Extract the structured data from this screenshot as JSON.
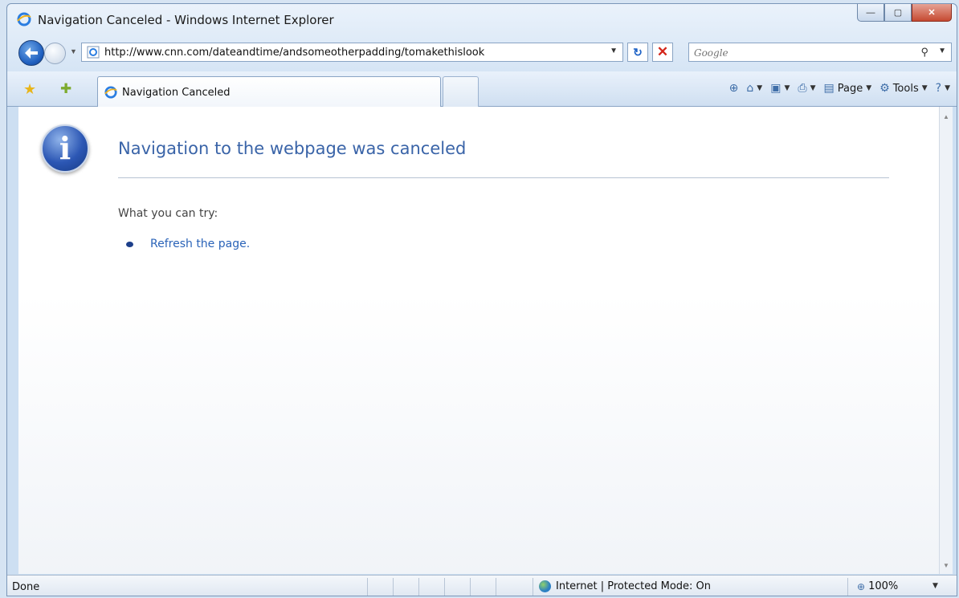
{
  "window": {
    "title": "Navigation Canceled - Windows Internet Explorer",
    "caption": {
      "minimize": "—",
      "maximize": "▢",
      "close": "✕"
    }
  },
  "address_bar": {
    "url": "http://www.cnn.com/dateandtime/andsomeotherpadding/tomakethislook"
  },
  "search": {
    "placeholder": "Google"
  },
  "tab": {
    "label": "Navigation Canceled"
  },
  "command_bar": {
    "page_label": "Page",
    "tools_label": "Tools"
  },
  "content": {
    "heading": "Navigation to the webpage was canceled",
    "try_label": "What you can try:",
    "refresh_link": "Refresh the page."
  },
  "status_bar": {
    "status": "Done",
    "zone": "Internet | Protected Mode: On",
    "zoom": "100%"
  },
  "icons": {
    "back": "back-arrow-icon",
    "forward": "forward-arrow-icon",
    "favorites": "star-icon",
    "add_favorites": "add-star-icon",
    "info": "info-icon",
    "globe": "globe-icon"
  }
}
